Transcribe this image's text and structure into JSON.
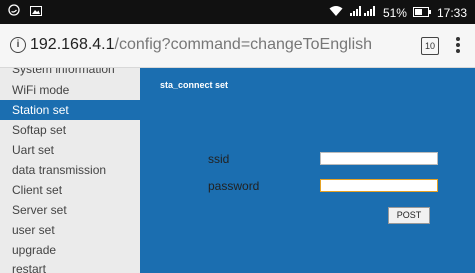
{
  "status_bar": {
    "signal_text": "51%",
    "time": "17:33"
  },
  "browser": {
    "url_host": "192.168.4.1",
    "url_path": "/config?command=changeToEnglish",
    "tab_count": "10"
  },
  "sidebar": {
    "items": [
      {
        "label": "System information"
      },
      {
        "label": "WiFi mode"
      },
      {
        "label": "Station set"
      },
      {
        "label": "Softap set"
      },
      {
        "label": "Uart set"
      },
      {
        "label": "data transmission"
      },
      {
        "label": "Client set"
      },
      {
        "label": "Server set"
      },
      {
        "label": "user set"
      },
      {
        "label": "upgrade"
      },
      {
        "label": "restart"
      }
    ],
    "active_index": 2
  },
  "form": {
    "title": "sta_connect set",
    "ssid_label": "ssid",
    "ssid_value": "",
    "password_label": "password",
    "password_value": "",
    "submit_label": "POST"
  },
  "colors": {
    "accent": "#1b6eb0",
    "sidebar_bg": "#ebebeb",
    "input_focus": "#e5a224"
  }
}
